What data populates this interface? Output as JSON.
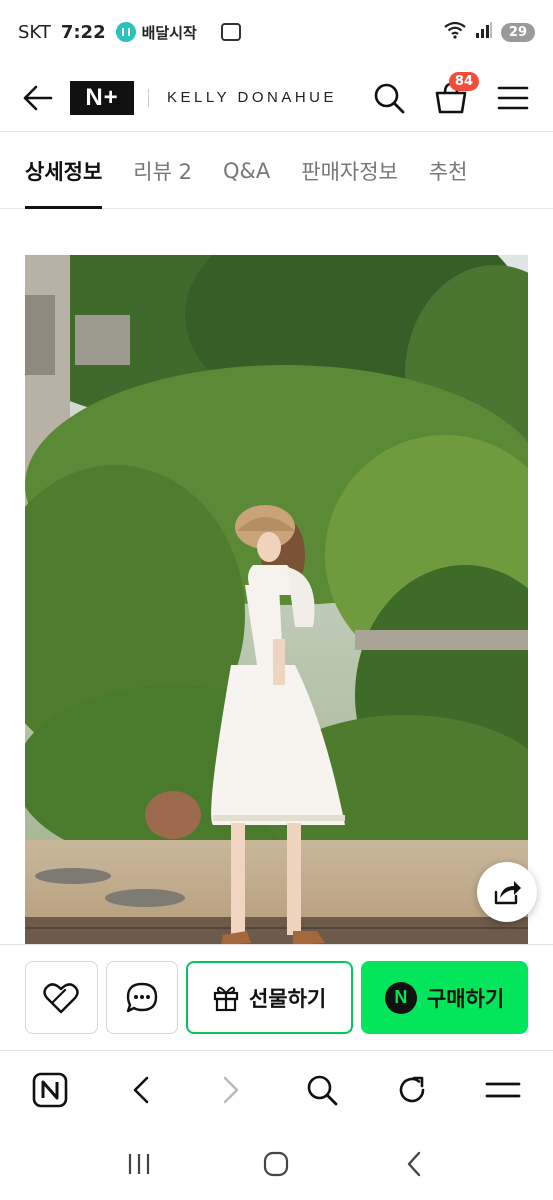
{
  "status_bar": {
    "carrier": "SKT",
    "time": "7:22",
    "app_notification": "배달시작",
    "battery": "29"
  },
  "header": {
    "logo": "N+",
    "brand": "KELLY DONAHUE",
    "cart_count": "84"
  },
  "tabs": [
    {
      "label": "상세정보",
      "active": true
    },
    {
      "label": "리뷰 2",
      "active": false
    },
    {
      "label": "Q&A",
      "active": false
    },
    {
      "label": "판매자정보",
      "active": false
    },
    {
      "label": "추천",
      "active": false
    }
  ],
  "actions": {
    "gift_label": "선물하기",
    "buy_label": "구매하기",
    "buy_icon_letter": "N"
  },
  "browser": {
    "home_letter": "N"
  },
  "colors": {
    "naver_green": "#03e65b",
    "gift_border": "#03c75a",
    "badge_red": "#f04e3b"
  },
  "icons": [
    "back-arrow-icon",
    "search-icon",
    "cart-icon",
    "menu-icon",
    "share-icon",
    "heart-icon",
    "chat-icon",
    "gift-icon",
    "reload-icon"
  ]
}
